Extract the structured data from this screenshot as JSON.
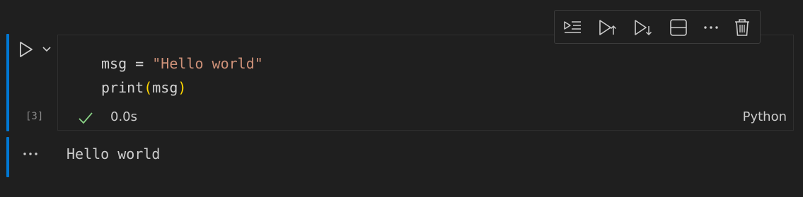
{
  "cell": {
    "execution_count": "[3]",
    "code_lines": [
      {
        "var": "msg",
        "op": " = ",
        "str": "\"Hello world\""
      },
      {
        "fn": "print",
        "open": "(",
        "arg": "msg",
        "close": ")"
      }
    ],
    "status": {
      "icon": "check-icon",
      "time": "0.0s"
    },
    "language": "Python"
  },
  "toolbar": {
    "buttons": [
      {
        "icon": "run-by-line-icon"
      },
      {
        "icon": "execute-above-icon"
      },
      {
        "icon": "execute-below-icon"
      },
      {
        "icon": "split-cell-icon"
      },
      {
        "icon": "more-actions-icon"
      },
      {
        "icon": "trash-icon"
      }
    ]
  },
  "output": {
    "text": "Hello world"
  },
  "colors": {
    "accent": "#0078d4",
    "background": "#1f1f1f",
    "string": "#ce9178",
    "function": "#dcdcaa",
    "bracket": "#ffd700",
    "success": "#89d185"
  }
}
